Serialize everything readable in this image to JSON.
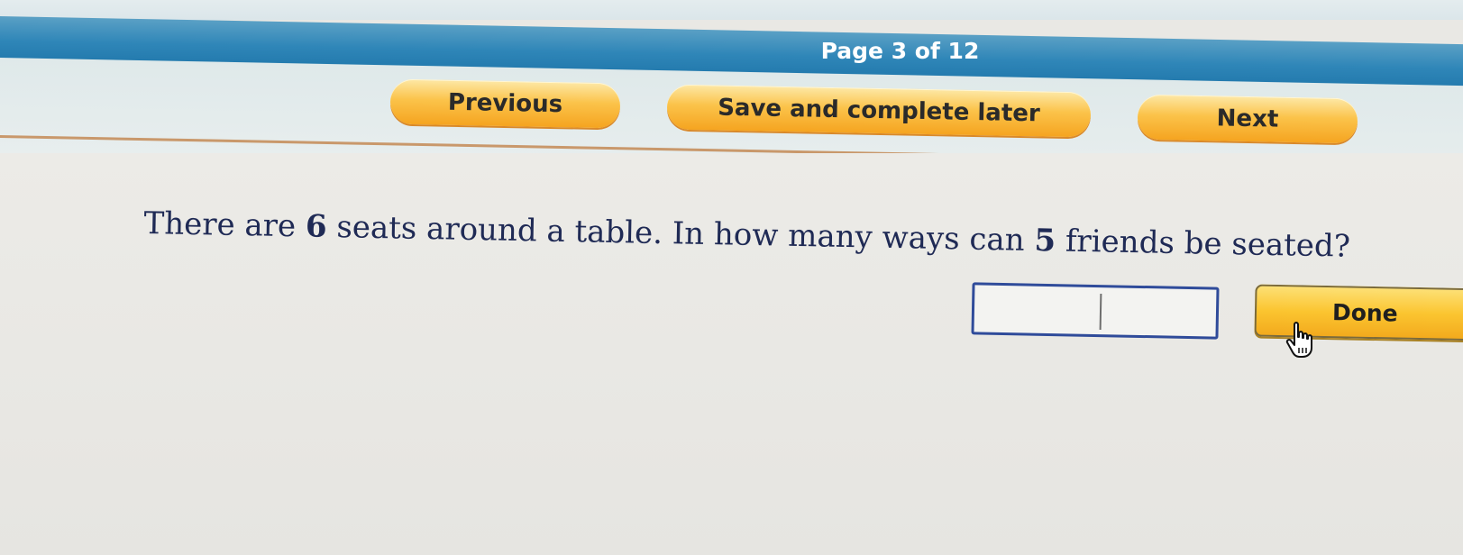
{
  "header": {
    "page_indicator": "Page 3 of 12"
  },
  "nav": {
    "previous_label": "Previous",
    "save_label": "Save and complete later",
    "next_label": "Next"
  },
  "question": {
    "part1": "There are ",
    "seats": "6",
    "part2": " seats around a table. In how many ways can ",
    "friends": "5",
    "part3": " friends be seated?"
  },
  "answer": {
    "value": "",
    "done_label": "Done"
  },
  "colors": {
    "header_blue": "#1f76aa",
    "button_orange": "#f5a420",
    "input_border": "#2f4b9a",
    "question_text": "#1f2a55"
  },
  "icons": {
    "cursor": "hand-pointer-icon"
  }
}
